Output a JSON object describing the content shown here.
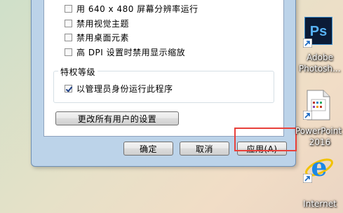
{
  "compat_options": [
    {
      "label": "用 640 x 480 屏幕分辨率运行",
      "checked": false
    },
    {
      "label": "禁用视觉主题",
      "checked": false
    },
    {
      "label": "禁用桌面元素",
      "checked": false
    },
    {
      "label": "高 DPI 设置时禁用显示缩放",
      "checked": false
    }
  ],
  "privilege": {
    "title": "特权等级",
    "run_as_admin_label": "以管理员身份运行此程序",
    "run_as_admin_checked": true
  },
  "change_all_users_button": "更改所有用户的设置",
  "buttons": {
    "ok": "确定",
    "cancel": "取消",
    "apply": "应用(A)"
  },
  "desktop_icons": [
    {
      "name": "photoshop",
      "label_line1": "Adobe",
      "label_line2": "Photosh...",
      "glyph": "Ps",
      "color": "#0d1f3c",
      "accent": "#31a8ff"
    },
    {
      "name": "powerpoint",
      "label_line1": "PowerPoint",
      "label_line2": "2016"
    },
    {
      "name": "internet",
      "label_line1": "Internet"
    }
  ]
}
